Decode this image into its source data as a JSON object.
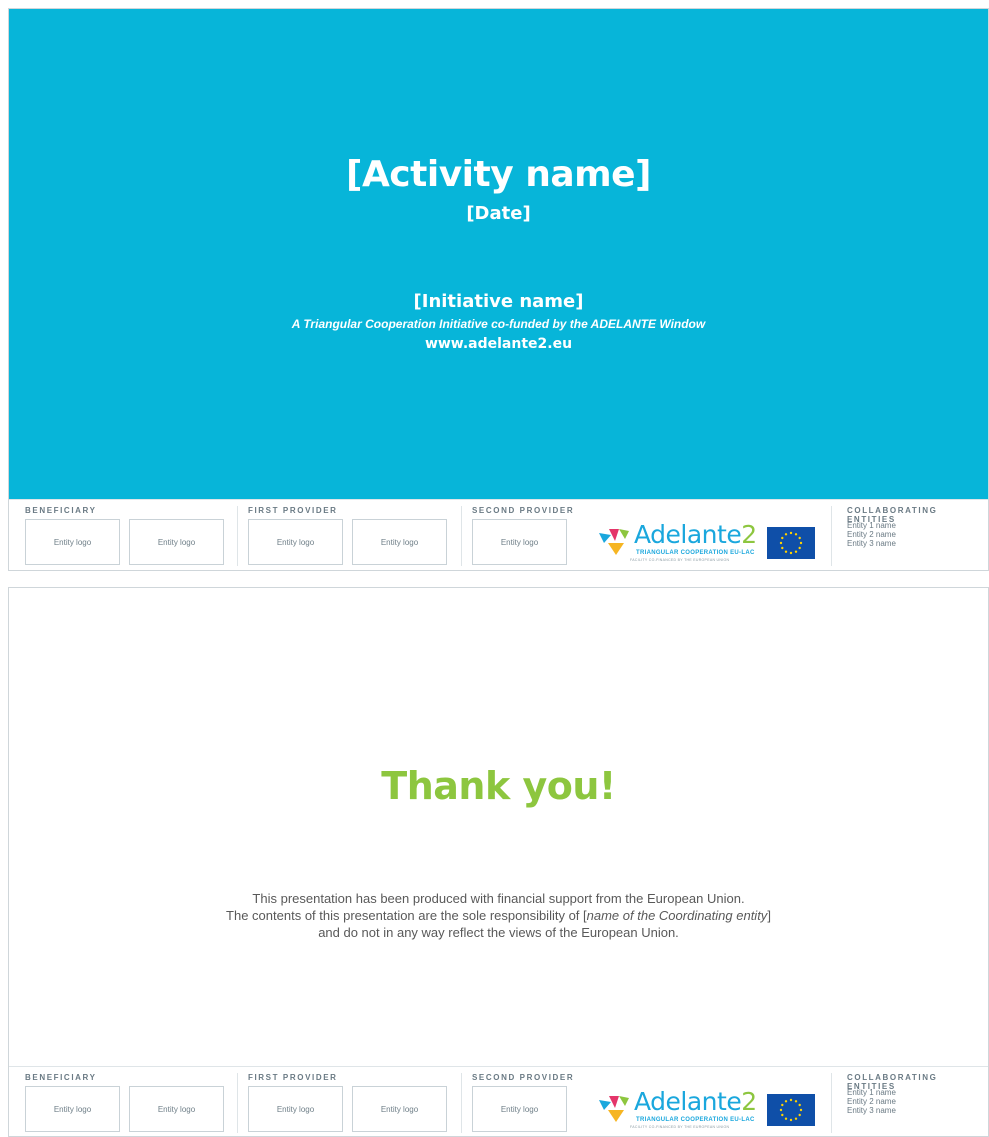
{
  "slide1": {
    "title": "[Activity name]",
    "date": "[Date]",
    "initiative": "[Initiative name]",
    "subtitle": "A Triangular Cooperation Initiative co-funded by the ADELANTE Window",
    "website": "www.adelante2.eu",
    "background_color": "#07b5d9"
  },
  "slide2": {
    "thanks": "Thank you!",
    "disclaimer_line1": "This presentation has been produced with financial support from the European Union.",
    "disclaimer_line2_pre": "The contents of this presentation are the sole responsibility of [",
    "disclaimer_line2_em": "name of the Coordinating entity",
    "disclaimer_line2_post": "]",
    "disclaimer_line3": "and do not in any way reflect the views of the European Union.",
    "thanks_color": "#8dc63f"
  },
  "footer": {
    "beneficiary_label": "BENEFICIARY",
    "first_provider_label": "FIRST PROVIDER",
    "second_provider_label": "SECOND PROVIDER",
    "collaborating_label": "COLLABORATING ENTITIES",
    "entity_logo": "Entity logo",
    "entities": [
      "Entity 1 name",
      "Entity 2 name",
      "Entity 3 name"
    ],
    "brand_name": "Adelante",
    "brand_number": "2",
    "brand_tagline": "TRIANGULAR COOPERATION EU-LAC",
    "brand_subtagline": "FACILITY CO-FINANCED BY THE EUROPEAN UNION",
    "brand_color": "#1aa7dd",
    "eu_flag_color": "#0f4fa8"
  }
}
